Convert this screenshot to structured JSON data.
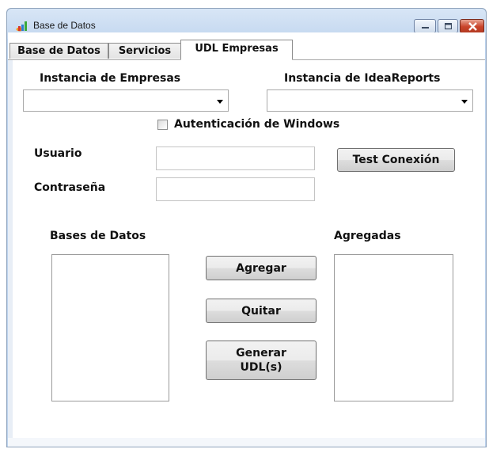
{
  "window": {
    "title": "Base de Datos",
    "controls": {
      "minimize": "minimize-icon",
      "maximize": "maximize-icon",
      "close": "close-icon"
    }
  },
  "tabs": [
    {
      "label": "Base de Datos",
      "active": false
    },
    {
      "label": "Servicios",
      "active": false
    },
    {
      "label": "UDL Empresas",
      "active": true
    }
  ],
  "form": {
    "instancia_empresas_label": "Instancia de Empresas",
    "instancia_empresas_value": "",
    "instancia_ideareports_label": "Instancia de IdeaReports",
    "instancia_ideareports_value": "",
    "autenticacion_label": "Autenticación de Windows",
    "autenticacion_checked": false,
    "usuario_label": "Usuario",
    "usuario_value": "",
    "contrasena_label": "Contraseña",
    "contrasena_value": "",
    "test_button": "Test Conexión",
    "bases_label": "Bases de  Datos",
    "agregadas_label": "Agregadas",
    "agregar_button": "Agregar",
    "quitar_button": "Quitar",
    "generar_button": "Generar\nUDL(s)"
  },
  "colors": {
    "accent": "#bcd3ee",
    "close_button": "#c9442a"
  }
}
